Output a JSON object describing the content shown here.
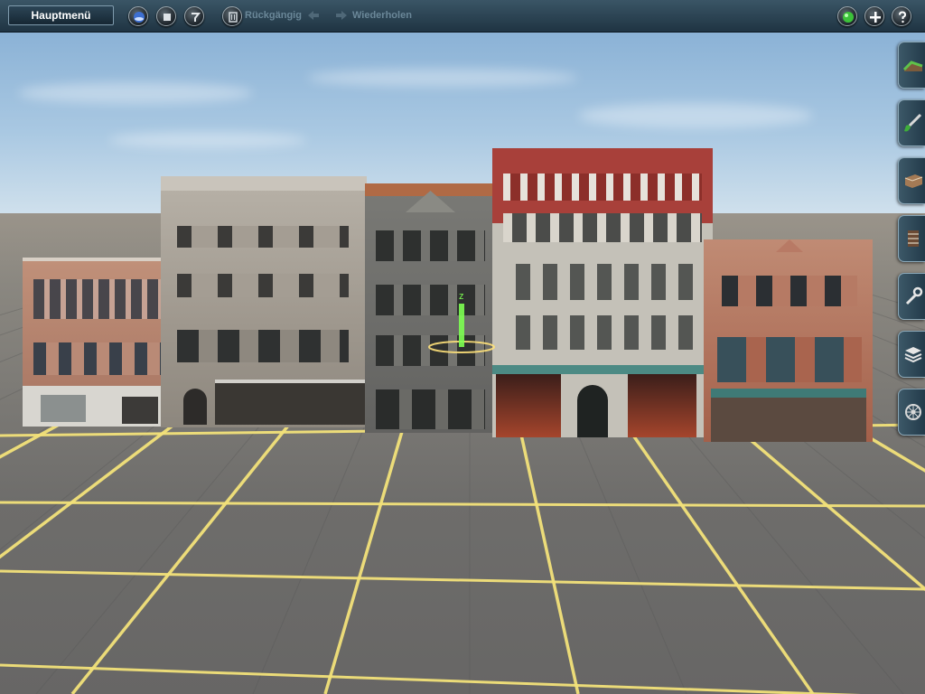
{
  "toolbar": {
    "main_menu_label": "Hauptmenü",
    "undo_label": "Rückgängig",
    "redo_label": "Wiederholen",
    "left_buttons": [
      "globe-icon",
      "stop-icon",
      "query-icon",
      "bin-icon"
    ],
    "right_buttons": [
      "green-indicator-icon",
      "add-icon",
      "help-icon"
    ]
  },
  "side_tabs": [
    {
      "name": "terrain-tool-tab",
      "icon": "terrain-icon"
    },
    {
      "name": "paint-tool-tab",
      "icon": "paint-brush-icon"
    },
    {
      "name": "objects-tool-tab",
      "icon": "object-block-icon"
    },
    {
      "name": "track-tool-tab",
      "icon": "track-icon"
    },
    {
      "name": "settings-tool-tab",
      "icon": "wrench-icon"
    },
    {
      "name": "layers-tool-tab",
      "icon": "layers-icon"
    },
    {
      "name": "driver-tool-tab",
      "icon": "wheel-icon"
    }
  ],
  "scene": {
    "grid_color": "#f3e27a",
    "gizmo_label": "z",
    "gizmo_color": "#7dff52",
    "buildings": [
      {
        "name": "building-red-brick-left",
        "color": "#b8806a"
      },
      {
        "name": "building-grey-stone",
        "color": "#a39c92"
      },
      {
        "name": "building-dark-grey-narrow",
        "color": "#6d6d69"
      },
      {
        "name": "building-red-white-ornate",
        "color": "#a8403a"
      },
      {
        "name": "building-red-brick-right",
        "color": "#b06d55"
      }
    ]
  }
}
